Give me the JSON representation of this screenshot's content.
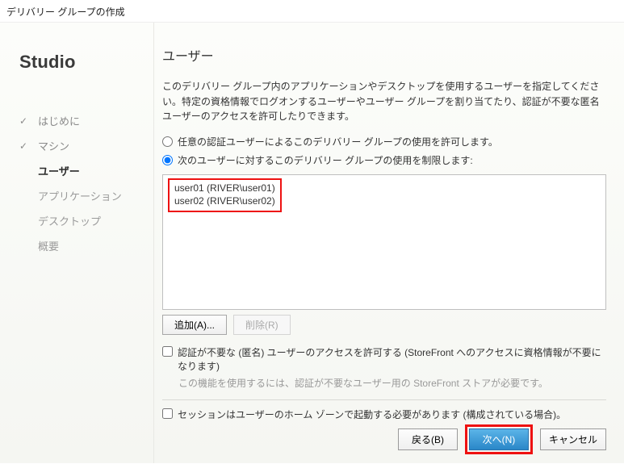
{
  "window": {
    "title": "デリバリー グループの作成"
  },
  "sidebar": {
    "brand": "Studio",
    "steps": [
      {
        "label": "はじめに",
        "state": "done"
      },
      {
        "label": "マシン",
        "state": "done"
      },
      {
        "label": "ユーザー",
        "state": "current"
      },
      {
        "label": "アプリケーション",
        "state": "future"
      },
      {
        "label": "デスクトップ",
        "state": "future"
      },
      {
        "label": "概要",
        "state": "future"
      }
    ]
  },
  "content": {
    "title": "ユーザー",
    "instruction": "このデリバリー グループ内のアプリケーションやデスクトップを使用するユーザーを指定してください。特定の資格情報でログオンするユーザーやユーザー グループを割り当てたり、認証が不要な匿名ユーザーのアクセスを許可したりできます。",
    "radio": {
      "allow_any": "任意の認証ユーザーによるこのデリバリー グループの使用を許可します。",
      "restrict": "次のユーザーに対するこのデリバリー グループの使用を制限します:",
      "selected": "restrict"
    },
    "userlist": [
      "user01 (RIVER\\user01)",
      "user02 (RIVER\\user02)"
    ],
    "listButtons": {
      "add": "追加(A)...",
      "remove": "削除(R)"
    },
    "anonCheck": {
      "label": "認証が不要な (匿名) ユーザーのアクセスを許可する (StoreFront へのアクセスに資格情報が不要になります)",
      "note": "この機能を使用するには、認証が不要なユーザー用の StoreFront ストアが必要です。"
    },
    "homeZoneCheck": {
      "label": "セッションはユーザーのホーム ゾーンで起動する必要があります (構成されている場合)。"
    }
  },
  "footer": {
    "back": "戻る(B)",
    "next": "次へ(N)",
    "cancel": "キャンセル"
  }
}
